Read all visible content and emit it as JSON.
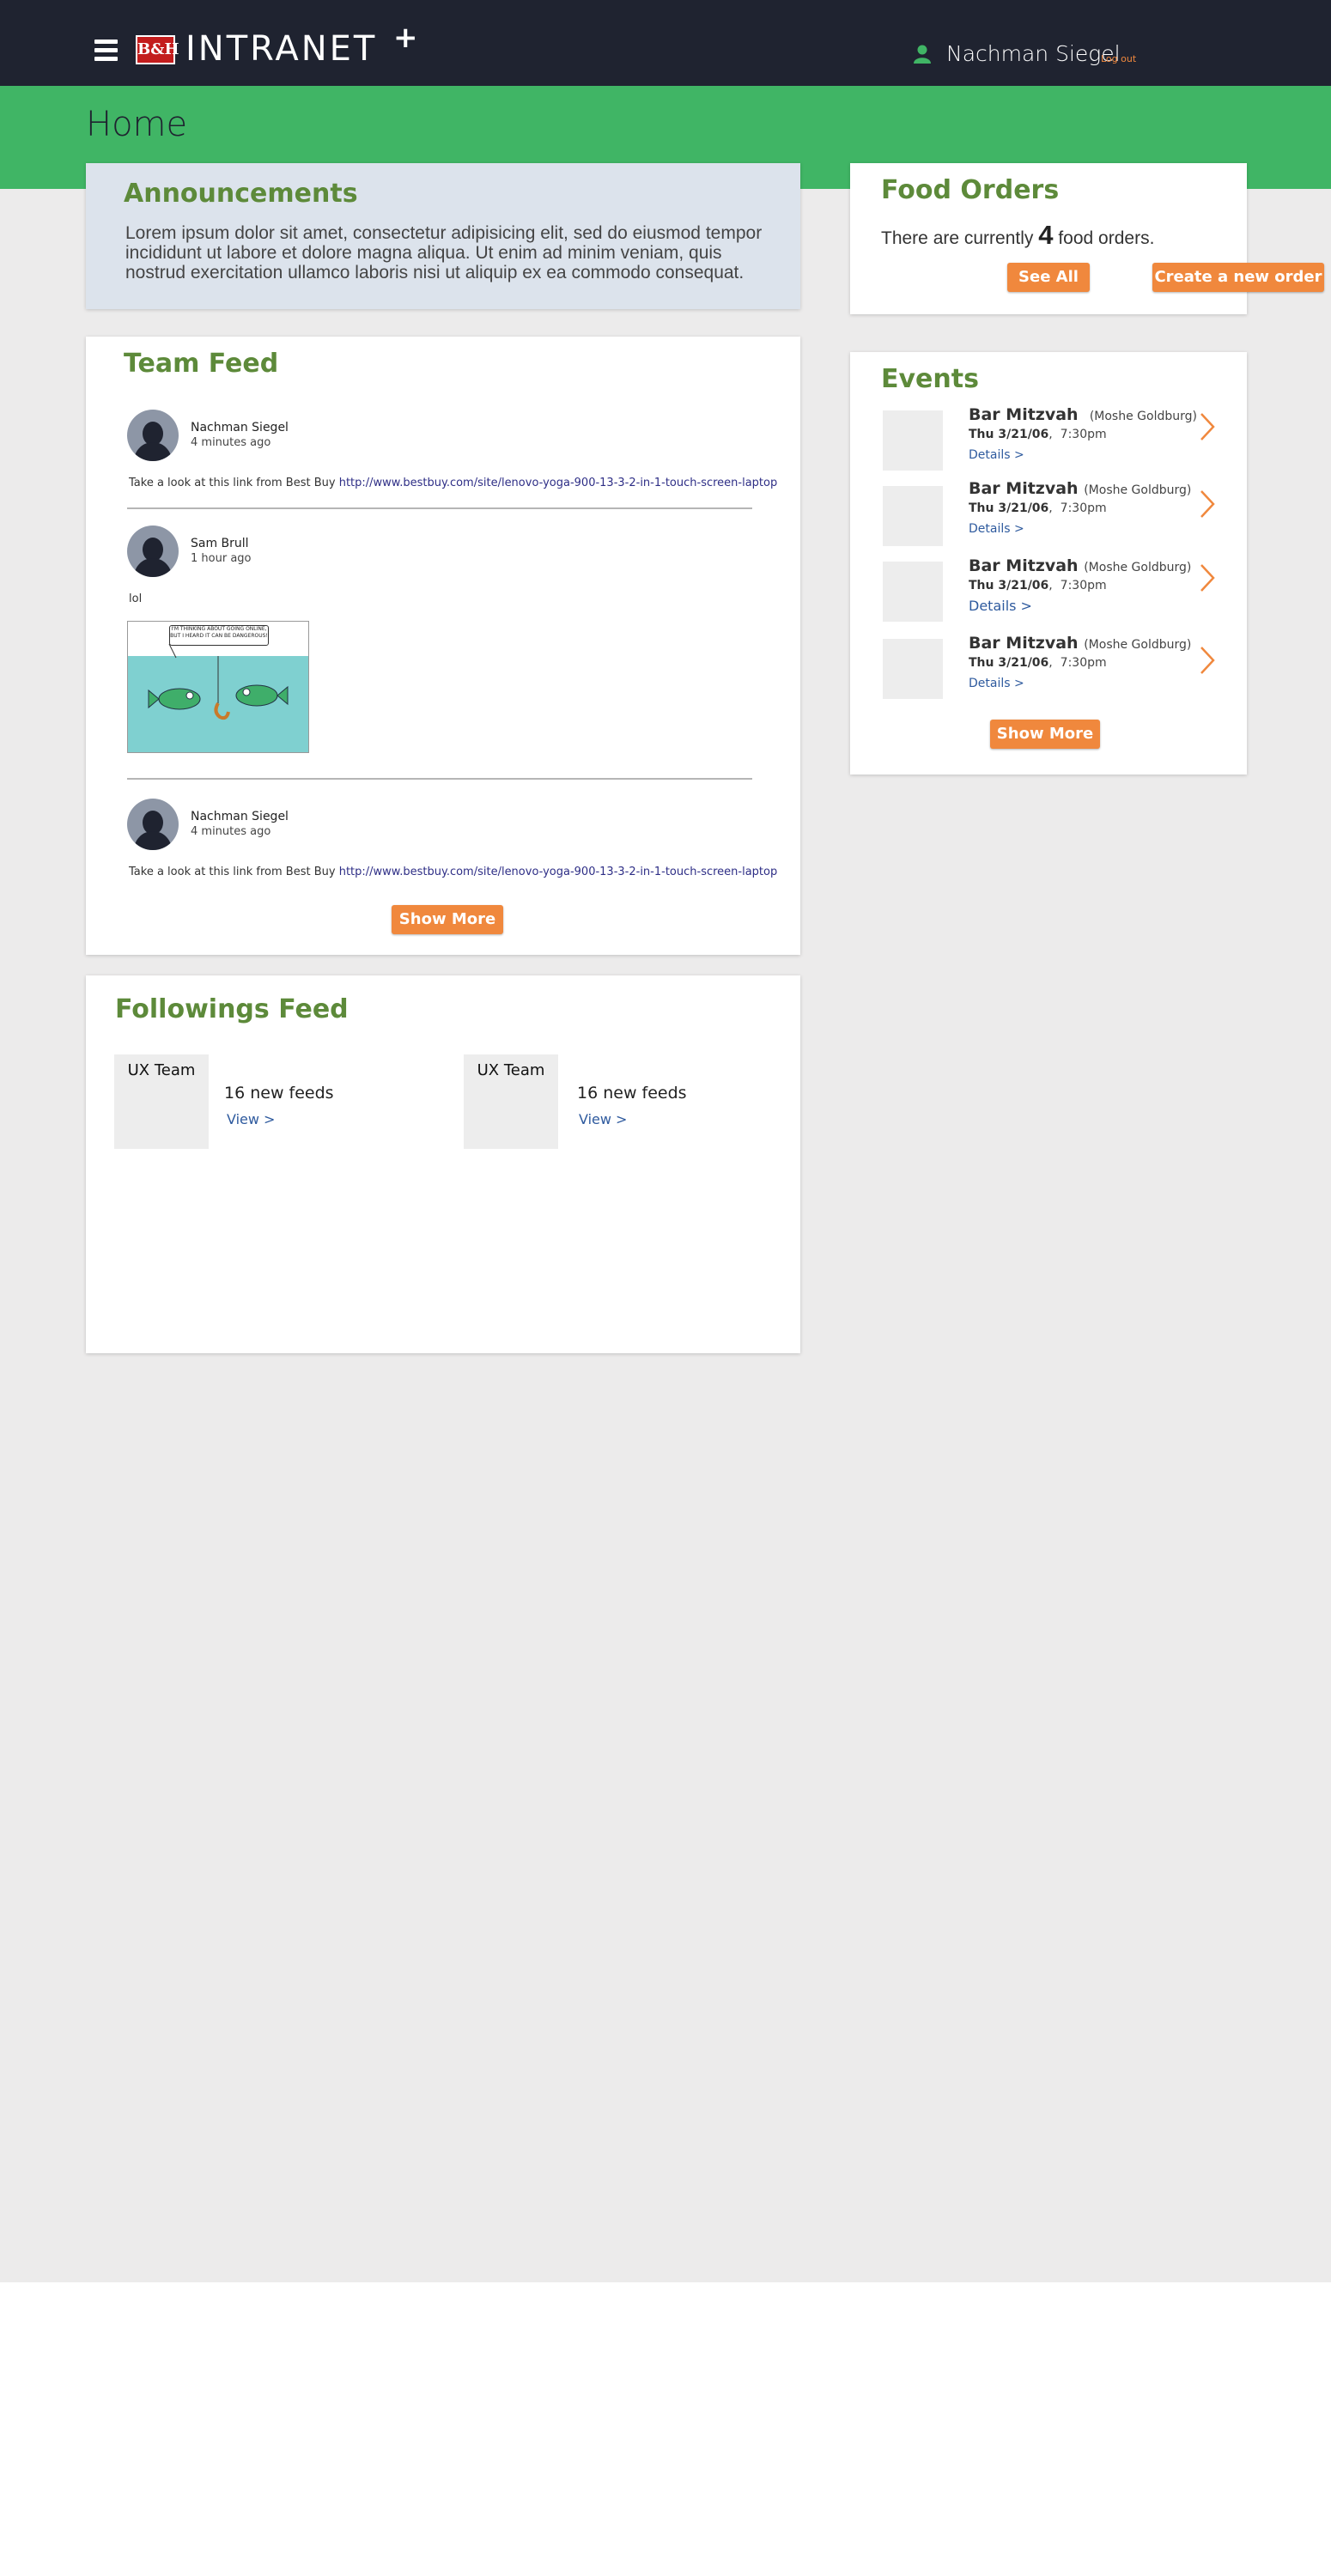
{
  "header": {
    "logo_text": "B&H",
    "brand": "INTRANET",
    "brand_plus": "+",
    "user_name": "Nachman Siegel",
    "logout": "Log out"
  },
  "page": {
    "title": "Home"
  },
  "announcements": {
    "title": "Announcements",
    "body": "Lorem ipsum dolor sit amet, consectetur adipisicing elit, sed do eiusmod tempor incididunt ut labore et dolore magna aliqua. Ut enim ad minim veniam, quis nostrud exercitation ullamco laboris nisi ut aliquip ex ea commodo consequat."
  },
  "team_feed": {
    "title": "Team Feed",
    "posts": [
      {
        "name": "Nachman Siegel",
        "time": "4 minutes ago",
        "text": "Take a look at this link from Best Buy",
        "link": "http://www.bestbuy.com/site/lenovo-yoga-900-13-3-2-in-1-touch-screen-laptop"
      },
      {
        "name": "Sam Brull",
        "time": "1 hour ago",
        "text": "lol",
        "comic_caption": "I'M THINKING ABOUT GOING ONLINE, BUT I HEARD IT CAN BE DANGEROUS!"
      },
      {
        "name": "Nachman Siegel",
        "time": "4 minutes ago",
        "text": "Take a look at this link from Best Buy",
        "link": "http://www.bestbuy.com/site/lenovo-yoga-900-13-3-2-in-1-touch-screen-laptop"
      }
    ],
    "show_more": "Show More"
  },
  "followings_feed": {
    "title": "Followings Feed",
    "items": [
      {
        "team": "UX Team",
        "count": "16 new feeds",
        "link": "View >"
      },
      {
        "team": "UX Team",
        "count": "16 new feeds",
        "link": "View >"
      }
    ]
  },
  "food_orders": {
    "title": "Food Orders",
    "prefix": "There are currently",
    "count": "4",
    "suffix": "food orders.",
    "see_all": "See All",
    "create": "Create a new order"
  },
  "events": {
    "title": "Events",
    "items": [
      {
        "title": "Bar Mitzvah",
        "host": "(Moshe Goldburg)",
        "date": "Thu 3/21/06",
        "time": "7:30pm",
        "details": "Details >"
      },
      {
        "title": "Bar Mitzvah",
        "host": "(Moshe Goldburg)",
        "date": "Thu 3/21/06",
        "time": "7:30pm",
        "details": "Details >"
      },
      {
        "title": "Bar Mitzvah",
        "host": "(Moshe Goldburg)",
        "date": "Thu 3/21/06",
        "time": "7:30pm",
        "details": "Details >"
      },
      {
        "title": "Bar Mitzvah",
        "host": "(Moshe Goldburg)",
        "date": "Thu 3/21/06",
        "time": "7:30pm",
        "details": "Details >"
      }
    ],
    "show_more": "Show More"
  },
  "colors": {
    "topbar": "#1f2330",
    "green_band": "#40b565",
    "accent_orange": "#f0883d",
    "title_green": "#5d8a3a"
  }
}
